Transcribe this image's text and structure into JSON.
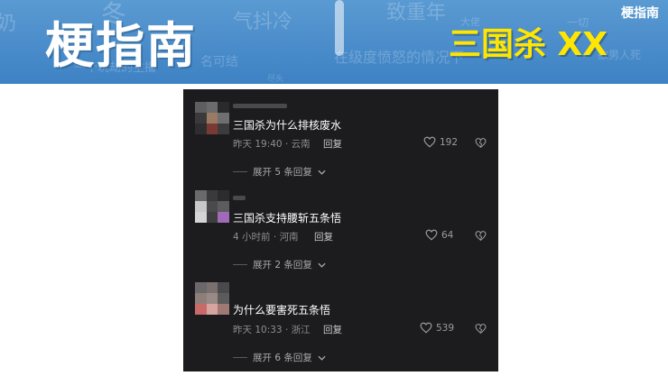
{
  "banner": {
    "title": "梗指南",
    "game": "三国杀 XX",
    "corner_tag": "梗指南",
    "bg_words": [
      "气抖冷",
      "致重年",
      "一个玩劫的主播",
      "在级度愤怒的情况下",
      "欲男人死",
      "奶",
      "冬",
      "名可结",
      "大佬",
      "尽头",
      "一切"
    ]
  },
  "comments": [
    {
      "text": "三国杀为什么排核废水",
      "time": "昨天 19:40",
      "location": "云南",
      "reply": "回复",
      "likes": "192",
      "expand": "展开 5 条回复"
    },
    {
      "text": "三国杀支持腰斩五条悟",
      "time": "4 小时前",
      "location": "河南",
      "reply": "回复",
      "likes": "64",
      "expand": "展开 2 条回复"
    },
    {
      "text": "为什么要害死五条悟",
      "time": "昨天 10:33",
      "location": "浙江",
      "reply": "回复",
      "likes": "539",
      "expand": "展开 6 条回复"
    }
  ],
  "meta_separator": "·",
  "colors": {
    "banner_bg": "#4a8dcb",
    "game_title": "#ffe600",
    "panel_bg": "#1c1c1e"
  }
}
